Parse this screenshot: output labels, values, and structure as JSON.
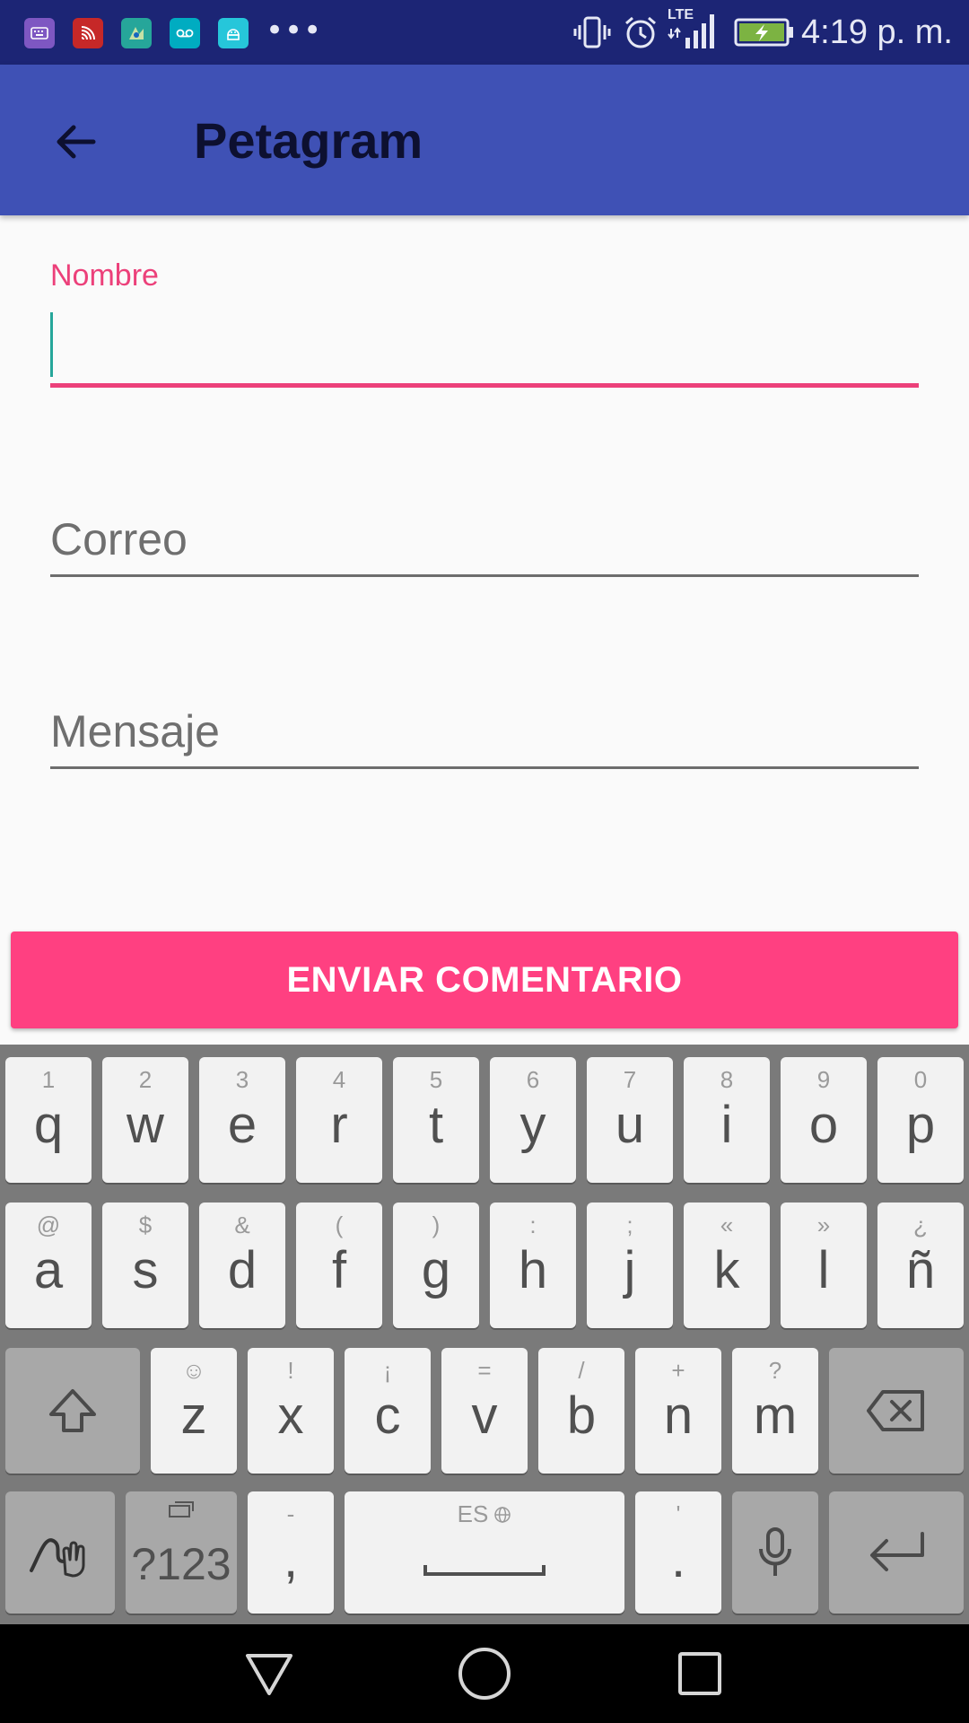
{
  "status_bar": {
    "time": "4:19 p. m.",
    "more": "•••",
    "network": "LTE",
    "colors": {
      "background": "#1c2575",
      "keyboard_icon": "#7e57c2",
      "cast_icon": "#c62828",
      "map_icon": "#26a69a",
      "voicemail_icon": "#00acc1",
      "android_icon": "#26c6da"
    },
    "icons": [
      "keyboard-icon",
      "cast-icon",
      "map-icon",
      "voicemail-icon",
      "android-icon",
      "vibrate-icon",
      "alarm-icon",
      "signal-icon",
      "battery-charging-icon"
    ]
  },
  "app_bar": {
    "title": "Petagram",
    "back_icon": "arrow-back-icon",
    "color": "#3f51b5"
  },
  "form": {
    "name_label": "Nombre",
    "name_value": "",
    "email_placeholder": "Correo",
    "message_placeholder": "Mensaje",
    "accent_color": "#ff4081"
  },
  "submit_label": "ENVIAR COMENTARIO",
  "keyboard": {
    "row1": [
      {
        "k": "q",
        "h": "1"
      },
      {
        "k": "w",
        "h": "2"
      },
      {
        "k": "e",
        "h": "3"
      },
      {
        "k": "r",
        "h": "4"
      },
      {
        "k": "t",
        "h": "5"
      },
      {
        "k": "y",
        "h": "6"
      },
      {
        "k": "u",
        "h": "7"
      },
      {
        "k": "i",
        "h": "8"
      },
      {
        "k": "o",
        "h": "9"
      },
      {
        "k": "p",
        "h": "0"
      }
    ],
    "row2": [
      {
        "k": "a",
        "h": "@"
      },
      {
        "k": "s",
        "h": "$"
      },
      {
        "k": "d",
        "h": "&"
      },
      {
        "k": "f",
        "h": "("
      },
      {
        "k": "g",
        "h": ")"
      },
      {
        "k": "h",
        "h": ":"
      },
      {
        "k": "j",
        "h": ";"
      },
      {
        "k": "k",
        "h": "«"
      },
      {
        "k": "l",
        "h": "»"
      },
      {
        "k": "ñ",
        "h": "¿"
      }
    ],
    "row3": [
      {
        "k": "z",
        "h": "☺"
      },
      {
        "k": "x",
        "h": "!"
      },
      {
        "k": "c",
        "h": "¡"
      },
      {
        "k": "v",
        "h": "="
      },
      {
        "k": "b",
        "h": "/"
      },
      {
        "k": "n",
        "h": "+"
      },
      {
        "k": "m",
        "h": "?"
      }
    ],
    "symbols_label": "?123",
    "comma": ",",
    "comma_hint": "-",
    "space_hint": "ES",
    "period": ".",
    "period_hint": "'"
  },
  "nav_bar": {
    "icons": [
      "back-triangle-icon",
      "home-circle-icon",
      "recents-square-icon"
    ]
  }
}
